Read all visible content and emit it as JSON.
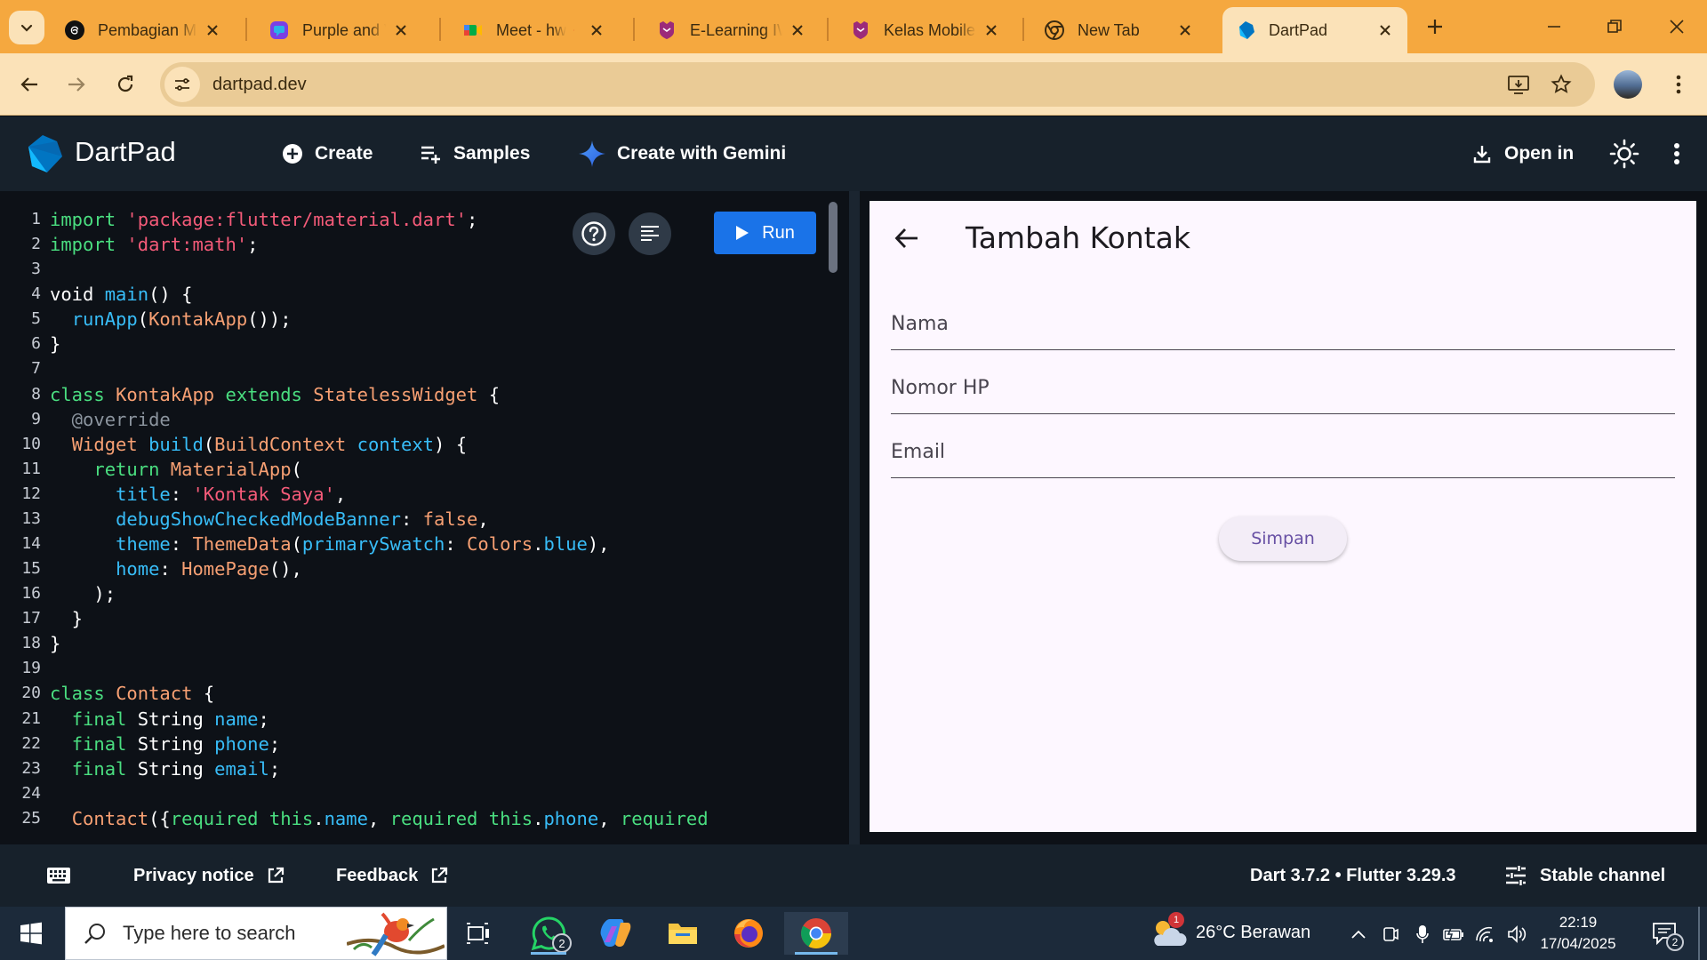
{
  "browser": {
    "tabs": [
      {
        "title": "Pembagian M",
        "favicon": "threads-icon"
      },
      {
        "title": "Purple and Vic",
        "favicon": "canva-icon"
      },
      {
        "title": "Meet - hw",
        "favicon": "meet-icon"
      },
      {
        "title": "E-Learning IW",
        "favicon": "elearning-icon"
      },
      {
        "title": "Kelas Mobile T",
        "favicon": "elearning-icon"
      },
      {
        "title": "New Tab",
        "favicon": "chrome-icon"
      },
      {
        "title": "DartPad",
        "favicon": "dart-icon"
      }
    ],
    "url": "dartpad.dev",
    "colors": {
      "frame": "#f5a83f",
      "toolbar": "#fbe2b8"
    }
  },
  "dartpad": {
    "title": "DartPad",
    "create_label": "Create",
    "samples_label": "Samples",
    "gemini_label": "Create with Gemini",
    "open_in_label": "Open in",
    "run_label": "Run",
    "code_lines": [
      [
        "1",
        [
          [
            "k",
            "import "
          ],
          [
            "s",
            "'package:flutter/material.dart'"
          ],
          [
            "tx",
            ";"
          ]
        ]
      ],
      [
        "2",
        [
          [
            "k",
            "import "
          ],
          [
            "s",
            "'dart:math'"
          ],
          [
            "tx",
            ";"
          ]
        ]
      ],
      [
        "3",
        []
      ],
      [
        "4",
        [
          [
            "tx",
            "void "
          ],
          [
            "f",
            "main"
          ],
          [
            "tx",
            "() {"
          ]
        ]
      ],
      [
        "5",
        [
          [
            "tx",
            "  "
          ],
          [
            "f",
            "runApp"
          ],
          [
            "tx",
            "("
          ],
          [
            "t",
            "KontakApp"
          ],
          [
            "tx",
            "());"
          ]
        ]
      ],
      [
        "6",
        [
          [
            "tx",
            "}"
          ]
        ]
      ],
      [
        "7",
        []
      ],
      [
        "8",
        [
          [
            "k",
            "class "
          ],
          [
            "t",
            "KontakApp "
          ],
          [
            "k",
            "extends "
          ],
          [
            "t",
            "StatelessWidget "
          ],
          [
            "tx",
            "{"
          ]
        ]
      ],
      [
        "9",
        [
          [
            "a",
            "  @override"
          ]
        ]
      ],
      [
        "10",
        [
          [
            "tx",
            "  "
          ],
          [
            "t",
            "Widget "
          ],
          [
            "f",
            "build"
          ],
          [
            "tx",
            "("
          ],
          [
            "t",
            "BuildContext "
          ],
          [
            "f",
            "context"
          ],
          [
            "tx",
            ") {"
          ]
        ]
      ],
      [
        "11",
        [
          [
            "tx",
            "    "
          ],
          [
            "k",
            "return "
          ],
          [
            "t",
            "MaterialApp"
          ],
          [
            "tx",
            "("
          ]
        ]
      ],
      [
        "12",
        [
          [
            "tx",
            "      "
          ],
          [
            "f",
            "title"
          ],
          [
            "tx",
            ": "
          ],
          [
            "s",
            "'Kontak Saya'"
          ],
          [
            "tx",
            ","
          ]
        ]
      ],
      [
        "13",
        [
          [
            "tx",
            "      "
          ],
          [
            "f",
            "debugShowCheckedModeBanner"
          ],
          [
            "tx",
            ": "
          ],
          [
            "t",
            "false"
          ],
          [
            "tx",
            ","
          ]
        ]
      ],
      [
        "14",
        [
          [
            "tx",
            "      "
          ],
          [
            "f",
            "theme"
          ],
          [
            "tx",
            ": "
          ],
          [
            "t",
            "ThemeData"
          ],
          [
            "tx",
            "("
          ],
          [
            "f",
            "primarySwatch"
          ],
          [
            "tx",
            ": "
          ],
          [
            "t",
            "Colors"
          ],
          [
            "tx",
            "."
          ],
          [
            "f",
            "blue"
          ],
          [
            "tx",
            "),"
          ]
        ]
      ],
      [
        "15",
        [
          [
            "tx",
            "      "
          ],
          [
            "f",
            "home"
          ],
          [
            "tx",
            ": "
          ],
          [
            "t",
            "HomePage"
          ],
          [
            "tx",
            "(),"
          ]
        ]
      ],
      [
        "16",
        [
          [
            "tx",
            "    );"
          ]
        ]
      ],
      [
        "17",
        [
          [
            "tx",
            "  }"
          ]
        ]
      ],
      [
        "18",
        [
          [
            "tx",
            "}"
          ]
        ]
      ],
      [
        "19",
        []
      ],
      [
        "20",
        [
          [
            "k",
            "class "
          ],
          [
            "t",
            "Contact "
          ],
          [
            "tx",
            "{"
          ]
        ]
      ],
      [
        "21",
        [
          [
            "tx",
            "  "
          ],
          [
            "k",
            "final "
          ],
          [
            "tx",
            "String "
          ],
          [
            "f",
            "name"
          ],
          [
            "tx",
            ";"
          ]
        ]
      ],
      [
        "22",
        [
          [
            "tx",
            "  "
          ],
          [
            "k",
            "final "
          ],
          [
            "tx",
            "String "
          ],
          [
            "f",
            "phone"
          ],
          [
            "tx",
            ";"
          ]
        ]
      ],
      [
        "23",
        [
          [
            "tx",
            "  "
          ],
          [
            "k",
            "final "
          ],
          [
            "tx",
            "String "
          ],
          [
            "f",
            "email"
          ],
          [
            "tx",
            ";"
          ]
        ]
      ],
      [
        "24",
        []
      ],
      [
        "25",
        [
          [
            "tx",
            "  "
          ],
          [
            "t",
            "Contact"
          ],
          [
            "tx",
            "({"
          ],
          [
            "k",
            "required "
          ],
          [
            "k",
            "this"
          ],
          [
            "tx",
            "."
          ],
          [
            "f",
            "name"
          ],
          [
            "tx",
            ", "
          ],
          [
            "k",
            "required "
          ],
          [
            "k",
            "this"
          ],
          [
            "tx",
            "."
          ],
          [
            "f",
            "phone"
          ],
          [
            "tx",
            ", "
          ],
          [
            "k",
            "required"
          ]
        ]
      ]
    ]
  },
  "preview": {
    "appbar_title": "Tambah Kontak",
    "name_placeholder": "Nama",
    "phone_placeholder": "Nomor HP",
    "email_placeholder": "Email",
    "save_label": "Simpan"
  },
  "footer": {
    "privacy_label": "Privacy notice",
    "feedback_label": "Feedback",
    "version_label": "Dart 3.7.2 • Flutter 3.29.3",
    "channel_label": "Stable channel"
  },
  "taskbar": {
    "search_placeholder": "Type here to search",
    "whatsapp_badge": "2",
    "weather_badge": "1",
    "weather": "26°C  Berawan",
    "time": "22:19",
    "date": "17/04/2025",
    "notification_count": "2"
  }
}
